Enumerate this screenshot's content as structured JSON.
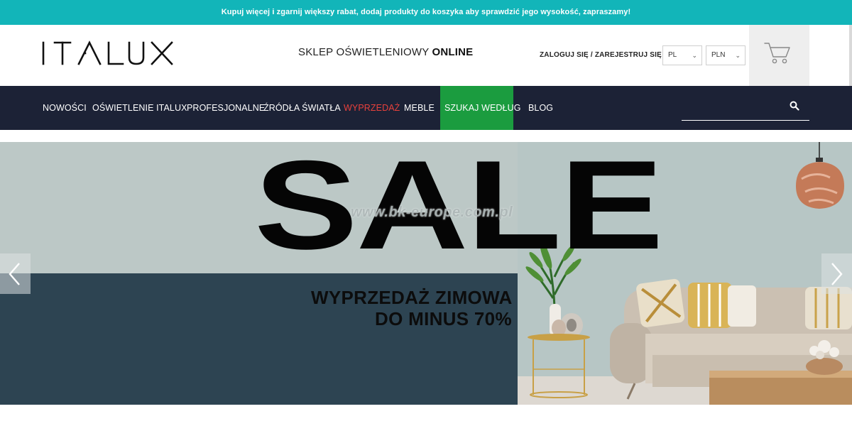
{
  "promo": {
    "text": "Kupuj więcej i zgarnij większy rabat, dodaj produkty do koszyka aby sprawdzić jego wysokość, zapraszamy!"
  },
  "header": {
    "logo_text": "ITALUX",
    "tagline_prefix": "SKLEP OŚWIETLENIOWY ",
    "tagline_bold": "ONLINE",
    "login_label": "ZALOGUJ SIĘ",
    "register_label": "/ ZAREJESTRUJ SIĘ",
    "language": "PL",
    "currency": "PLN",
    "cart_icon": "cart-icon"
  },
  "nav": {
    "items": [
      {
        "label": "NOWOŚCI"
      },
      {
        "label": "OŚWIETLENIE ITALUX"
      },
      {
        "label": "PROFESJONALNE"
      },
      {
        "label": "ŹRÓDŁA ŚWIATŁA"
      },
      {
        "label": "WYPRZEDAŻ"
      },
      {
        "label": "MEBLE"
      },
      {
        "label": "SZUKAJ WEDŁUG"
      },
      {
        "label": "BLOG"
      }
    ],
    "search_placeholder": "",
    "search_icon": "search-icon"
  },
  "hero": {
    "headline": "SALE",
    "watermark": "www.bk-europe.com.pl",
    "subtitle_line1": "WYPRZEDAŻ ZIMOWA",
    "subtitle_line2": "DO MINUS 70%",
    "prev_icon": "chevron-left-icon",
    "next_icon": "chevron-right-icon"
  },
  "colors": {
    "promo_bg": "#12b5b9",
    "nav_bg": "#1c2236",
    "sale_nav": "#e8413c",
    "highlight_nav": "#1b9c3f",
    "hero_panel": "#2d4452"
  }
}
